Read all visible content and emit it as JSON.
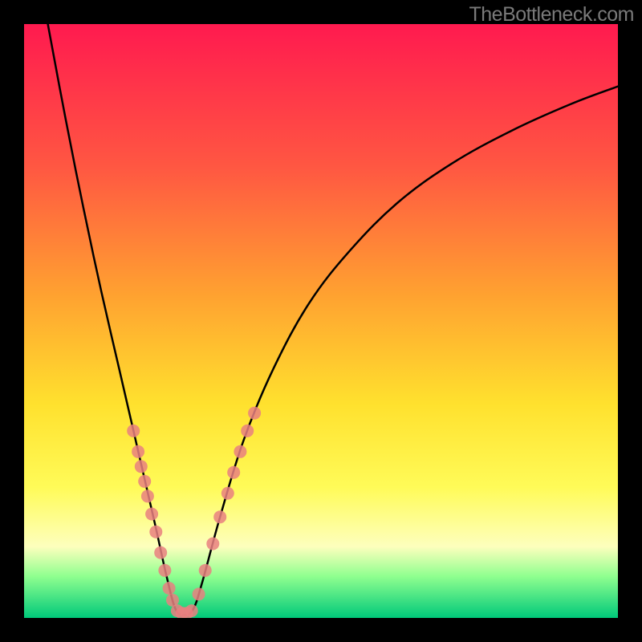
{
  "watermark": "TheBottleneck.com",
  "chart_data": {
    "type": "line",
    "title": "",
    "xlabel": "",
    "ylabel": "",
    "xlim": [
      0,
      100
    ],
    "ylim": [
      0,
      100
    ],
    "curve": {
      "name": "bottleneck-curve",
      "description": "V-shaped bottleneck curve dipping to zero near x≈27",
      "points": [
        {
          "x": 4.0,
          "y": 100.0
        },
        {
          "x": 7.0,
          "y": 84.0
        },
        {
          "x": 10.0,
          "y": 69.0
        },
        {
          "x": 13.0,
          "y": 55.0
        },
        {
          "x": 16.0,
          "y": 42.0
        },
        {
          "x": 19.0,
          "y": 29.0
        },
        {
          "x": 22.0,
          "y": 16.0
        },
        {
          "x": 24.0,
          "y": 7.0
        },
        {
          "x": 25.5,
          "y": 1.5
        },
        {
          "x": 27.0,
          "y": 0.5
        },
        {
          "x": 28.5,
          "y": 1.5
        },
        {
          "x": 30.0,
          "y": 6.0
        },
        {
          "x": 33.0,
          "y": 17.0
        },
        {
          "x": 37.0,
          "y": 30.0
        },
        {
          "x": 42.0,
          "y": 42.0
        },
        {
          "x": 48.0,
          "y": 53.0
        },
        {
          "x": 55.0,
          "y": 62.0
        },
        {
          "x": 63.0,
          "y": 70.0
        },
        {
          "x": 72.0,
          "y": 76.5
        },
        {
          "x": 82.0,
          "y": 82.0
        },
        {
          "x": 92.0,
          "y": 86.5
        },
        {
          "x": 100.0,
          "y": 89.5
        }
      ]
    },
    "markers_left": {
      "color": "#e98080",
      "points": [
        {
          "x": 18.4,
          "y": 31.5
        },
        {
          "x": 19.2,
          "y": 28.0
        },
        {
          "x": 19.7,
          "y": 25.5
        },
        {
          "x": 20.3,
          "y": 23.0
        },
        {
          "x": 20.8,
          "y": 20.5
        },
        {
          "x": 21.5,
          "y": 17.5
        },
        {
          "x": 22.2,
          "y": 14.5
        },
        {
          "x": 23.0,
          "y": 11.0
        },
        {
          "x": 23.7,
          "y": 8.0
        },
        {
          "x": 24.4,
          "y": 5.0
        },
        {
          "x": 25.0,
          "y": 3.0
        }
      ]
    },
    "markers_bottom": {
      "color": "#e98080",
      "points": [
        {
          "x": 25.8,
          "y": 1.2
        },
        {
          "x": 26.6,
          "y": 0.8
        },
        {
          "x": 27.4,
          "y": 0.8
        },
        {
          "x": 28.2,
          "y": 1.2
        }
      ]
    },
    "markers_right": {
      "color": "#e98080",
      "points": [
        {
          "x": 29.4,
          "y": 4.0
        },
        {
          "x": 30.5,
          "y": 8.0
        },
        {
          "x": 31.8,
          "y": 12.5
        },
        {
          "x": 33.0,
          "y": 17.0
        },
        {
          "x": 34.3,
          "y": 21.0
        },
        {
          "x": 35.3,
          "y": 24.5
        },
        {
          "x": 36.4,
          "y": 28.0
        },
        {
          "x": 37.6,
          "y": 31.5
        },
        {
          "x": 38.8,
          "y": 34.5
        }
      ]
    }
  }
}
